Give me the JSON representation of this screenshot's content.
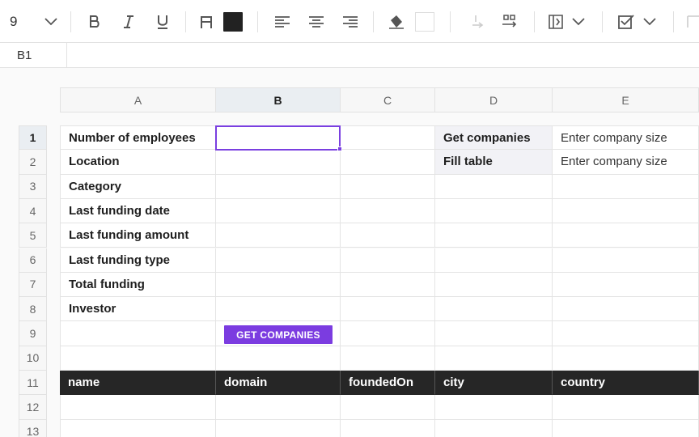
{
  "toolbar": {
    "font_size": "9",
    "icons": [
      "chevron-down-icon",
      "bold-icon",
      "italic-icon",
      "underline-icon",
      "text-color-icon",
      "align-left-icon",
      "align-center-icon",
      "align-right-icon",
      "fill-color-icon",
      "merge-cells-icon",
      "wrap-icon",
      "checkbox-icon"
    ],
    "text_color_swatch": "#222222",
    "fill_color_swatch": "#ffffff"
  },
  "formula_bar": {
    "name_box": "B1"
  },
  "columns": [
    "A",
    "B",
    "C",
    "D",
    "E"
  ],
  "active_column": "B",
  "rows": [
    "1",
    "2",
    "3",
    "4",
    "5",
    "6",
    "7",
    "8",
    "9",
    "10",
    "11",
    "12",
    "13"
  ],
  "active_row": "1",
  "cells": {
    "A1": "Number of employees",
    "A2": "Location",
    "A3": "Category",
    "A4": "Last funding date",
    "A5": "Last funding amount",
    "A6": "Last funding type",
    "A7": "Total funding",
    "A8": "Investor",
    "D1": "Get companies",
    "D2": "Fill table",
    "E1": "Enter company size",
    "E2": "Enter company size"
  },
  "button": {
    "label": "GET COMPANIES"
  },
  "table_header": {
    "A11": "name",
    "B11": "domain",
    "C11": "foundedOn",
    "D11": "city",
    "E11": "country"
  },
  "accent_color": "#7b3ce0"
}
